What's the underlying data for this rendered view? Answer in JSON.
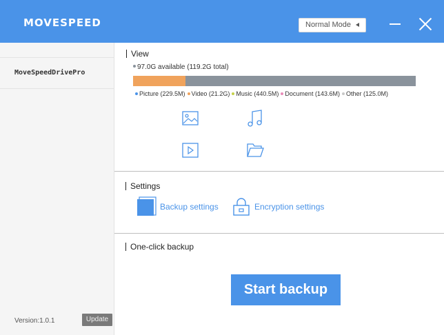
{
  "app": {
    "brand": "MOVESPEED"
  },
  "titlebar": {
    "mode": "Normal Mode"
  },
  "sidebar": {
    "device": "MoveSpeedDrivePro",
    "version": "Version:1.0.1",
    "update_label": "Update"
  },
  "view": {
    "title": "View",
    "available": "97.0G available (119.2G total)",
    "used_fraction_picture": 0.185,
    "legend": [
      {
        "label": "Picture (229.5M)",
        "color": "#4a93e8"
      },
      {
        "label": "Video (21.2G)",
        "color": "#f0a35c"
      },
      {
        "label": "Music (440.5M)",
        "color": "#c6d24a"
      },
      {
        "label": "Document (143.6M)",
        "color": "#e98bb8"
      },
      {
        "label": "Other (125.0M)",
        "color": "#c8c8c8"
      }
    ],
    "icons": [
      "picture-icon",
      "music-icon",
      "video-icon",
      "folder-icon"
    ]
  },
  "settings": {
    "title": "Settings",
    "backup_label": "Backup settings",
    "encryption_label": "Encryption settings"
  },
  "oneclick": {
    "title": "One-click backup",
    "start_label": "Start backup"
  },
  "colors": {
    "accent": "#4a93e8",
    "storage_used": "#f0a35c",
    "storage_rest": "#8a939c"
  }
}
